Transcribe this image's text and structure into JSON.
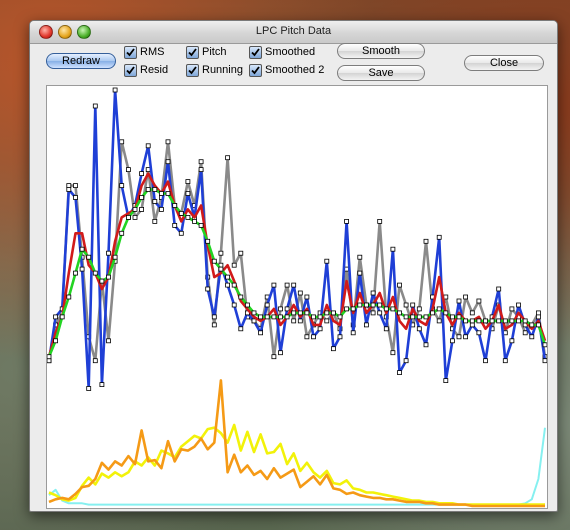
{
  "window": {
    "title": "LPC Pitch Data"
  },
  "buttons": {
    "redraw": "Redraw",
    "smooth": "Smooth",
    "save": "Save",
    "close": "Close"
  },
  "checkboxes": {
    "rms": {
      "label": "RMS",
      "checked": true
    },
    "resid": {
      "label": "Resid",
      "checked": true
    },
    "pitch": {
      "label": "Pitch",
      "checked": true
    },
    "running": {
      "label": "Running",
      "checked": true
    },
    "smoothed": {
      "label": "Smoothed",
      "checked": true
    },
    "smoothed2": {
      "label": "Smoothed 2",
      "checked": true
    }
  },
  "chart_data": {
    "type": "line",
    "x": [
      0,
      1,
      2,
      3,
      4,
      5,
      6,
      7,
      8,
      9,
      10,
      11,
      12,
      13,
      14,
      15,
      16,
      17,
      18,
      19,
      20,
      21,
      22,
      23,
      24,
      25,
      26,
      27,
      28,
      29,
      30,
      31,
      32,
      33,
      34,
      35,
      36,
      37,
      38,
      39,
      40,
      41,
      42,
      43,
      44,
      45,
      46,
      47,
      48,
      49,
      50,
      51,
      52,
      53,
      54,
      55,
      56,
      57,
      58,
      59,
      60,
      61,
      62,
      63,
      64,
      65,
      66,
      67,
      68,
      69,
      70,
      71,
      72,
      73,
      74,
      75
    ],
    "xlim": [
      0,
      75
    ],
    "pitch_ylim": [
      0,
      1
    ],
    "level_ylim": [
      0,
      1
    ],
    "series": [
      {
        "color": "#8a8a8a",
        "role": "pitch-raw",
        "markers": true,
        "values": [
          0.34,
          0.43,
          0.46,
          0.78,
          0.78,
          0.6,
          0.4,
          0.34,
          0.54,
          0.39,
          0.59,
          0.89,
          0.82,
          0.7,
          0.72,
          0.82,
          0.69,
          0.75,
          0.89,
          0.73,
          0.71,
          0.79,
          0.73,
          0.84,
          0.55,
          0.43,
          0.61,
          0.85,
          0.58,
          0.61,
          0.45,
          0.44,
          0.42,
          0.5,
          0.35,
          0.47,
          0.53,
          0.44,
          0.51,
          0.4,
          0.43,
          0.46,
          0.44,
          0.46,
          0.42,
          0.57,
          0.43,
          0.6,
          0.48,
          0.46,
          0.69,
          0.45,
          0.36,
          0.53,
          0.48,
          0.43,
          0.47,
          0.64,
          0.47,
          0.44,
          0.5,
          0.42,
          0.4,
          0.5,
          0.46,
          0.49,
          0.44,
          0.42,
          0.48,
          0.41,
          0.47,
          0.45,
          0.41,
          0.43,
          0.46,
          0.35
        ]
      },
      {
        "color": "#1f3fd6",
        "role": "pitch",
        "markers": true,
        "values": [
          0.34,
          0.45,
          0.47,
          0.77,
          0.75,
          0.57,
          0.27,
          0.98,
          0.28,
          0.61,
          1.02,
          0.78,
          0.7,
          0.73,
          0.81,
          0.88,
          0.74,
          0.72,
          0.84,
          0.68,
          0.66,
          0.76,
          0.7,
          0.82,
          0.52,
          0.45,
          0.58,
          0.53,
          0.48,
          0.42,
          0.46,
          0.44,
          0.41,
          0.48,
          0.53,
          0.36,
          0.47,
          0.53,
          0.44,
          0.5,
          0.4,
          0.42,
          0.59,
          0.37,
          0.4,
          0.69,
          0.41,
          0.56,
          0.43,
          0.51,
          0.46,
          0.42,
          0.62,
          0.31,
          0.34,
          0.48,
          0.42,
          0.38,
          0.5,
          0.65,
          0.29,
          0.39,
          0.49,
          0.4,
          0.43,
          0.41,
          0.34,
          0.45,
          0.52,
          0.34,
          0.39,
          0.48,
          0.43,
          0.4,
          0.45,
          0.34
        ]
      },
      {
        "color": "#d11a1a",
        "role": "pitch-running",
        "markers": false,
        "values": [
          0.35,
          0.41,
          0.45,
          0.56,
          0.66,
          0.66,
          0.58,
          0.56,
          0.52,
          0.55,
          0.64,
          0.7,
          0.71,
          0.72,
          0.78,
          0.81,
          0.78,
          0.76,
          0.79,
          0.73,
          0.69,
          0.72,
          0.7,
          0.73,
          0.63,
          0.55,
          0.56,
          0.58,
          0.54,
          0.49,
          0.47,
          0.45,
          0.44,
          0.45,
          0.47,
          0.43,
          0.45,
          0.48,
          0.45,
          0.47,
          0.43,
          0.43,
          0.48,
          0.44,
          0.43,
          0.54,
          0.46,
          0.51,
          0.46,
          0.48,
          0.51,
          0.46,
          0.5,
          0.44,
          0.42,
          0.47,
          0.44,
          0.43,
          0.47,
          0.55,
          0.46,
          0.43,
          0.46,
          0.44,
          0.44,
          0.45,
          0.42,
          0.44,
          0.48,
          0.42,
          0.43,
          0.46,
          0.44,
          0.42,
          0.44,
          0.39
        ]
      },
      {
        "color": "#22d422",
        "role": "pitch-smoothed",
        "markers": true,
        "values": [
          0.35,
          0.39,
          0.45,
          0.5,
          0.56,
          0.62,
          0.6,
          0.56,
          0.54,
          0.55,
          0.6,
          0.66,
          0.7,
          0.72,
          0.75,
          0.77,
          0.77,
          0.76,
          0.76,
          0.73,
          0.71,
          0.7,
          0.69,
          0.68,
          0.64,
          0.59,
          0.57,
          0.55,
          0.53,
          0.5,
          0.48,
          0.46,
          0.45,
          0.45,
          0.45,
          0.45,
          0.45,
          0.46,
          0.46,
          0.46,
          0.45,
          0.45,
          0.46,
          0.46,
          0.45,
          0.47,
          0.47,
          0.48,
          0.48,
          0.48,
          0.48,
          0.47,
          0.47,
          0.46,
          0.45,
          0.45,
          0.45,
          0.45,
          0.46,
          0.47,
          0.46,
          0.45,
          0.45,
          0.44,
          0.44,
          0.44,
          0.44,
          0.44,
          0.44,
          0.44,
          0.44,
          0.44,
          0.44,
          0.43,
          0.43,
          0.38
        ]
      },
      {
        "color": "#f2f20a",
        "role": "rms",
        "markers": false,
        "values": [
          0.1,
          0.08,
          0.05,
          0.04,
          0.06,
          0.15,
          0.21,
          0.16,
          0.24,
          0.21,
          0.25,
          0.22,
          0.25,
          0.33,
          0.3,
          0.36,
          0.3,
          0.41,
          0.39,
          0.36,
          0.44,
          0.48,
          0.52,
          0.5,
          0.57,
          0.58,
          0.54,
          0.47,
          0.6,
          0.41,
          0.55,
          0.4,
          0.53,
          0.39,
          0.4,
          0.46,
          0.31,
          0.39,
          0.26,
          0.32,
          0.25,
          0.21,
          0.26,
          0.17,
          0.16,
          0.19,
          0.13,
          0.12,
          0.1,
          0.1,
          0.09,
          0.08,
          0.07,
          0.06,
          0.05,
          0.04,
          0.04,
          0.03,
          0.03,
          0.02,
          0.02,
          0.02,
          0.01,
          0.01,
          0.01,
          0.01,
          0.01,
          0.01,
          0.01,
          0.01,
          0.01,
          0.01,
          0.01,
          0.01,
          0.01,
          0.01
        ]
      },
      {
        "color": "#f59a16",
        "role": "resid",
        "markers": false,
        "values": [
          0.03,
          0.05,
          0.06,
          0.05,
          0.09,
          0.14,
          0.15,
          0.2,
          0.32,
          0.27,
          0.33,
          0.3,
          0.37,
          0.31,
          0.56,
          0.33,
          0.34,
          0.28,
          0.48,
          0.33,
          0.42,
          0.41,
          0.44,
          0.5,
          0.42,
          0.47,
          0.93,
          0.25,
          0.38,
          0.25,
          0.3,
          0.23,
          0.26,
          0.2,
          0.28,
          0.21,
          0.24,
          0.27,
          0.14,
          0.18,
          0.22,
          0.16,
          0.23,
          0.13,
          0.12,
          0.09,
          0.1,
          0.08,
          0.07,
          0.06,
          0.06,
          0.05,
          0.05,
          0.04,
          0.03,
          0.03,
          0.03,
          0.02,
          0.02,
          0.01,
          0.01,
          0.01,
          0.01,
          0.01,
          0.0,
          0.0,
          0.0,
          0.0,
          0.0,
          0.0,
          0.0,
          0.0,
          0.0,
          0.0,
          0.0,
          0.0
        ]
      },
      {
        "color": "#86f0f0",
        "role": "level",
        "markers": false,
        "values": [
          0.08,
          0.12,
          0.04,
          0.02,
          0.02,
          0.02,
          0.01,
          0.01,
          0.01,
          0.01,
          0.01,
          0.01,
          0.01,
          0.01,
          0.01,
          0.01,
          0.01,
          0.01,
          0.01,
          0.01,
          0.01,
          0.01,
          0.01,
          0.01,
          0.01,
          0.01,
          0.01,
          0.01,
          0.01,
          0.01,
          0.01,
          0.01,
          0.01,
          0.01,
          0.01,
          0.01,
          0.01,
          0.01,
          0.01,
          0.01,
          0.01,
          0.01,
          0.01,
          0.01,
          0.01,
          0.01,
          0.01,
          0.01,
          0.01,
          0.01,
          0.01,
          0.01,
          0.01,
          0.01,
          0.01,
          0.01,
          0.01,
          0.01,
          0.01,
          0.01,
          0.01,
          0.01,
          0.01,
          0.01,
          0.01,
          0.01,
          0.01,
          0.01,
          0.01,
          0.01,
          0.01,
          0.01,
          0.02,
          0.05,
          0.2,
          0.58
        ]
      }
    ]
  }
}
